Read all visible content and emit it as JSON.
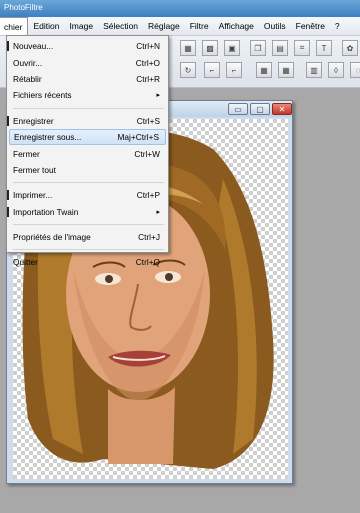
{
  "window": {
    "title": "PhotoFiltre"
  },
  "menubar": {
    "items": [
      {
        "label": "chier"
      },
      {
        "label": "Edition"
      },
      {
        "label": "Image"
      },
      {
        "label": "Sélection"
      },
      {
        "label": "Réglage"
      },
      {
        "label": "Filtre"
      },
      {
        "label": "Affichage"
      },
      {
        "label": "Outils"
      },
      {
        "label": "Fenêtre"
      },
      {
        "label": "?"
      }
    ]
  },
  "dropdown": {
    "items": [
      {
        "label": "Nouveau...",
        "shortcut": "Ctrl+N"
      },
      {
        "label": "Ouvrir...",
        "shortcut": "Ctrl+O"
      },
      {
        "label": "Rétablir",
        "shortcut": "Ctrl+R"
      },
      {
        "label": "Fichiers récents",
        "submenu": "▸"
      },
      {
        "label": "Enregistrer",
        "shortcut": "Ctrl+S"
      },
      {
        "label": "Enregistrer sous...",
        "shortcut": "Maj+Ctrl+S"
      },
      {
        "label": "Fermer",
        "shortcut": "Ctrl+W"
      },
      {
        "label": "Fermer tout"
      },
      {
        "label": "Imprimer...",
        "shortcut": "Ctrl+P"
      },
      {
        "label": "Importation Twain",
        "submenu": "▸"
      },
      {
        "label": "Propriétés de l'image",
        "shortcut": "Ctrl+J"
      },
      {
        "label": "Quitter",
        "shortcut": "Ctrl+Q"
      }
    ]
  },
  "docwindow": {
    "buttons": {
      "minimize": "▭",
      "maximize": "▢",
      "close": "✕"
    }
  },
  "icons": [
    "image-icon",
    "save-icon",
    "grid-icon",
    "text-tool-icon",
    "photo-icon"
  ]
}
